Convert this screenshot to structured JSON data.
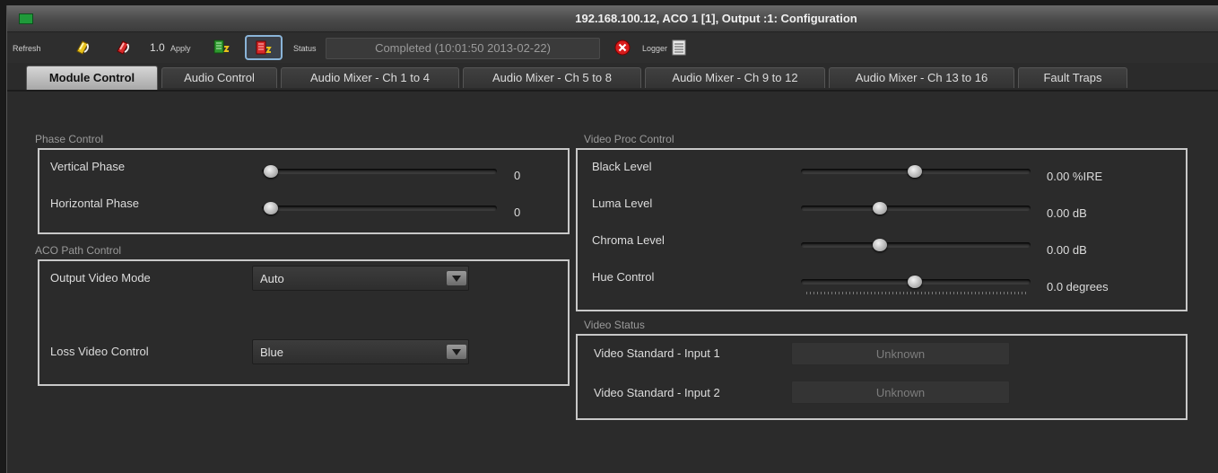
{
  "window": {
    "title": "192.168.100.12, ACO 1  [1], Output :1: Configuration"
  },
  "toolbar": {
    "refresh_label": "Refresh",
    "version_value": "1.0",
    "apply_label": "Apply",
    "status_label": "Status",
    "status_value": "Completed  (10:01:50  2013-02-22)",
    "logger_label": "Logger",
    "icons": [
      "refresh-icon",
      "apply-icon",
      "module-icon",
      "module-write-icon",
      "error-icon",
      "logger-icon"
    ]
  },
  "tabs": [
    {
      "label": "Module Control",
      "active": true
    },
    {
      "label": "Audio Control"
    },
    {
      "label": "Audio Mixer - Ch 1 to 4"
    },
    {
      "label": "Audio Mixer - Ch 5 to 8"
    },
    {
      "label": "Audio Mixer - Ch 9 to 12"
    },
    {
      "label": "Audio Mixer - Ch 13 to 16"
    },
    {
      "label": "Fault Traps"
    }
  ],
  "phase_control": {
    "title": "Phase Control",
    "vertical_label": "Vertical Phase",
    "vertical_value": "0",
    "horizontal_label": "Horizontal Phase",
    "horizontal_value": "0"
  },
  "aco_path": {
    "title": "ACO Path Control",
    "output_mode_label": "Output Video Mode",
    "output_mode_value": "Auto",
    "loss_video_label": "Loss Video Control",
    "loss_video_value": "Blue"
  },
  "video_proc": {
    "title": "Video Proc Control",
    "black_label": "Black Level",
    "black_value": "0.00 %IRE",
    "luma_label": "Luma Level",
    "luma_value": "0.00 dB",
    "chroma_label": "Chroma Level",
    "chroma_value": "0.00 dB",
    "hue_label": "Hue Control",
    "hue_value": "0.0 degrees"
  },
  "video_status": {
    "title": "Video Status",
    "input1_label": "Video Standard - Input 1",
    "input1_value": "Unknown",
    "input2_label": "Video Standard - Input 2",
    "input2_value": "Unknown"
  },
  "colors": {
    "accent_frame": "#8ab4d8",
    "groupbox_border": "#c8c8c8",
    "error_red": "#d81c1c"
  }
}
